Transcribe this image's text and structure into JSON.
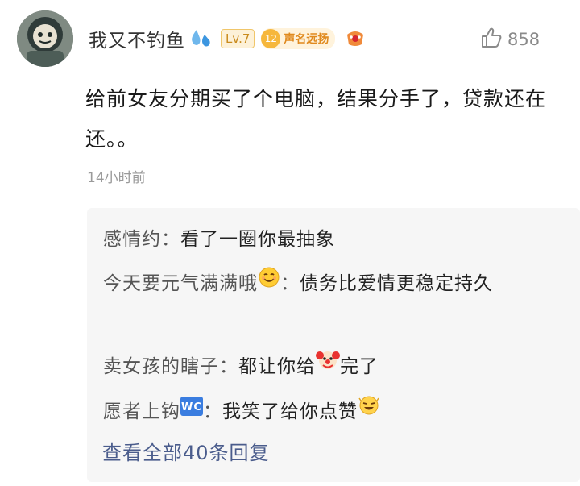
{
  "comment": {
    "user": {
      "name": "我又不钓鱼",
      "level": "Lv.7",
      "fame_level": "12",
      "fame_title": "声名远扬"
    },
    "likes": "858",
    "text": "给前女友分期买了个电脑，结果分手了，贷款还在还。。",
    "time": "14小时前"
  },
  "replies": [
    {
      "name": "感情约",
      "sep": "：",
      "text": "看了一圈你最抽象"
    },
    {
      "name": "今天要元气满满哦",
      "sep": "：",
      "text": "债务比爱情更稳定持久"
    },
    {
      "name": "卖女孩的瞎子",
      "sep": "：",
      "text_before": "都让你给",
      "text_after": "完了"
    },
    {
      "name": "愿者上钩",
      "badge": "wc",
      "sep": "：",
      "text": "我笑了给你点赞"
    }
  ],
  "view_all_label": "查看全部40条回复",
  "icons": {
    "drop": "water-drops-icon",
    "fan": "fan-badge-icon",
    "like": "thumbs-up-icon",
    "smile": "smile-emoji-icon",
    "clown": "clown-emoji-icon",
    "laugh": "laugh-emoji-icon",
    "wc": "wc-badge-icon"
  },
  "colors": {
    "link": "#4a5c8c",
    "reply_bg": "#f6f6f6",
    "meta": "#9a9a9a",
    "level_badge": "#c98a1c",
    "fame_badge": "#e08a1e"
  }
}
